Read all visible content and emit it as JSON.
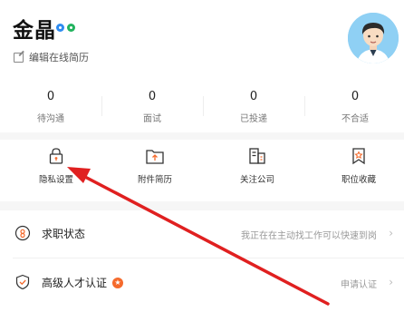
{
  "profile": {
    "name": "金晶",
    "edit_label": "编辑在线简历"
  },
  "stats": [
    {
      "value": "0",
      "label": "待沟通"
    },
    {
      "value": "0",
      "label": "面试"
    },
    {
      "value": "0",
      "label": "已投递"
    },
    {
      "value": "0",
      "label": "不合适"
    }
  ],
  "quick_actions": [
    {
      "label": "隐私设置",
      "icon": "lock-icon"
    },
    {
      "label": "附件简历",
      "icon": "folder-upload-icon"
    },
    {
      "label": "关注公司",
      "icon": "building-icon"
    },
    {
      "label": "职位收藏",
      "icon": "bookmark-star-icon"
    }
  ],
  "menu": [
    {
      "title": "求职状态",
      "value": "我正在在主动找工作可以快速到岗",
      "icon": "job-status-icon"
    },
    {
      "title": "高级人才认证",
      "value": "申请认证",
      "icon": "shield-check-icon"
    }
  ],
  "colors": {
    "accent": "#f56a2c",
    "arrow": "#e02020",
    "icon_stroke": "#333333",
    "badge_blue": "#2f8cf0",
    "badge_green": "#22b35e"
  }
}
